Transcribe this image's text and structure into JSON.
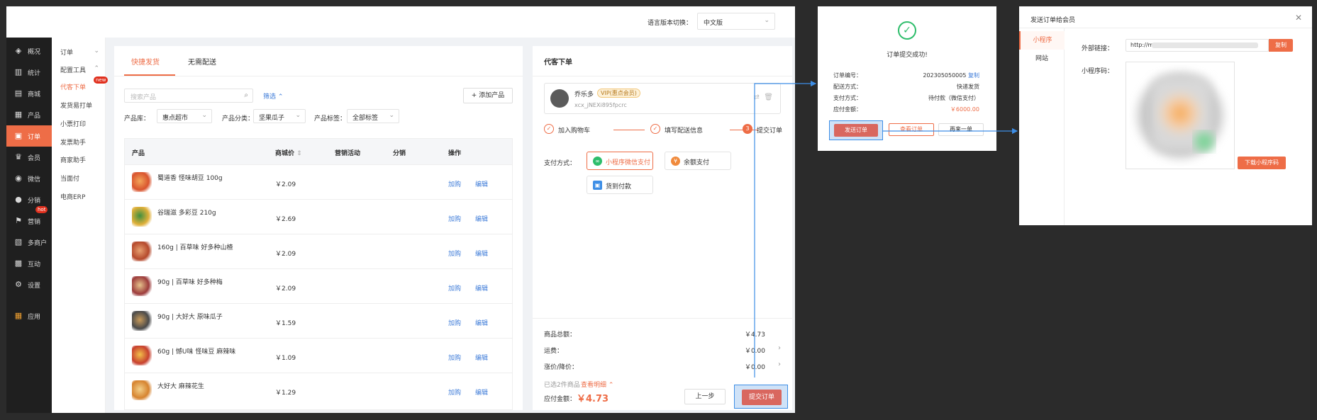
{
  "topbar": {
    "lang_label": "语言版本切换：",
    "lang_value": "中文版"
  },
  "sidebar": {
    "items": [
      {
        "label": "概况",
        "icon": "layers-icon"
      },
      {
        "label": "统计",
        "icon": "chart-icon"
      },
      {
        "label": "商城",
        "icon": "store-icon"
      },
      {
        "label": "产品",
        "icon": "grid-icon"
      },
      {
        "label": "订单",
        "icon": "order-icon"
      },
      {
        "label": "会员",
        "icon": "crown-icon"
      },
      {
        "label": "微信",
        "icon": "wechat-icon"
      },
      {
        "label": "分销",
        "icon": "users-icon"
      },
      {
        "label": "营销",
        "icon": "flag-icon"
      },
      {
        "label": "多商户",
        "icon": "shop-icon"
      },
      {
        "label": "互动",
        "icon": "apps-icon"
      },
      {
        "label": "设置",
        "icon": "gear-icon"
      },
      {
        "label": "应用",
        "icon": "app-grid-icon"
      }
    ],
    "hot_badge": "hot"
  },
  "subnav": {
    "group1": "订单",
    "group2": "配置工具",
    "items": [
      "代客下单",
      "发货易打单",
      "小票打印",
      "发票助手",
      "商家助手",
      "当面付",
      "电商ERP"
    ],
    "new_badge": "new"
  },
  "products": {
    "tabs": [
      "快捷发货",
      "无需配送"
    ],
    "search_placeholder": "搜索产品",
    "filter": "筛选",
    "add_label": "添加产品",
    "filters": [
      {
        "label": "产品库：",
        "value": "惠点超市"
      },
      {
        "label": "产品分类：",
        "value": "坚果瓜子"
      },
      {
        "label": "产品标签：",
        "value": "全部标签"
      }
    ],
    "headers": [
      "产品",
      "商城价",
      "营销活动",
      "分销",
      "操作"
    ],
    "rows": [
      {
        "name": "蜀道香 怪味胡豆 100g",
        "price": "￥2.09"
      },
      {
        "name": "谷瑞滋 多彩豆 210g",
        "price": "￥2.69"
      },
      {
        "name": "160g | 百草味 好多种山楂",
        "price": "￥2.09"
      },
      {
        "name": "90g | 百草味 好多种梅",
        "price": "￥2.09"
      },
      {
        "name": "90g | 大好大 原味瓜子",
        "price": "￥1.59"
      },
      {
        "name": "60g | 憾U味 怪味豆 麻辣味",
        "price": "￥1.09"
      },
      {
        "name": "大好大 麻辣花生",
        "price": "￥1.29"
      }
    ],
    "buy_label": "加购",
    "edit_label": "编辑"
  },
  "order": {
    "title": "代客下单",
    "customer_name": "乔乐多",
    "vip": "VIP(惠点会员)",
    "customer_id": "xcx_jNEXi895fpcrc",
    "steps": [
      "加入购物车",
      "填写配送信息",
      "提交订单"
    ],
    "step3_num": "3",
    "pay_label": "支付方式：",
    "pay_options": [
      "小程序微信支付",
      "余额支付",
      "货到付款"
    ],
    "summary": [
      {
        "label": "商品总额：",
        "value": "￥4.73"
      },
      {
        "label": "运费：",
        "value": "￥0.00"
      },
      {
        "label": "涨价/降价：",
        "value": "￥0.00"
      }
    ],
    "selected": "已选2件商品",
    "view_detail": "查看明细",
    "due_label": "应付金额：",
    "due_amount": "￥4.73",
    "prev": "上一步",
    "submit": "提交订单"
  },
  "success": {
    "title": "订单提交成功!",
    "rows": [
      {
        "label": "订单编号：",
        "value": "202305050005"
      },
      {
        "label": "配送方式：",
        "value": "快递发货"
      },
      {
        "label": "支付方式：",
        "value": "待付款（微信支付）"
      },
      {
        "label": "应付金额：",
        "value": "￥6000.00"
      }
    ],
    "copy": "复制",
    "send": "发送订单",
    "view": "查看订单",
    "again": "再来一单"
  },
  "send_dialog": {
    "title": "发送订单给会员",
    "tabs": [
      "小程序",
      "网站"
    ],
    "ext_label": "外部链接：",
    "ext_value": "http://m",
    "copy": "复制",
    "qr_label": "小程序码：",
    "download": "下载小程序码"
  },
  "colors": {
    "accent": "#ee6d47",
    "link": "#3d7bd8",
    "highlight": "#3d8ee6",
    "success": "#2ebd6b"
  }
}
